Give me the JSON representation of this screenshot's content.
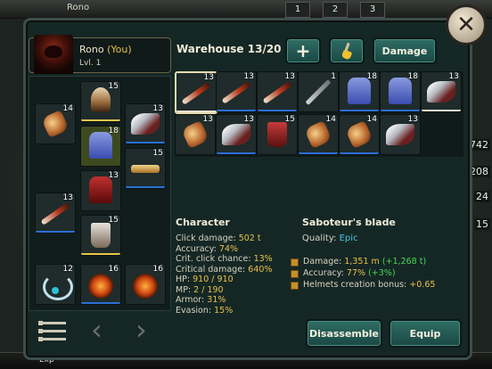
{
  "background": {
    "top_name": "Rono",
    "top_slots": [
      "1",
      "2",
      "3"
    ],
    "right_numbers": [
      "742",
      "208",
      "24",
      "15"
    ],
    "exp_label": "Exp"
  },
  "hero": {
    "name": "Rono",
    "you_label": "(You)",
    "level": "Lvl. 1"
  },
  "equipment": [
    {
      "name": "gauntlet-slot",
      "count": "14",
      "icon": "gauntlet-icon",
      "bar": ""
    },
    {
      "name": "helmet-slot",
      "count": "15",
      "icon": "helmet-icon",
      "bar": "#e8c54a"
    },
    {
      "name": "wings-slot",
      "count": "13",
      "icon": "wings-icon",
      "bar": "#2b6fd6"
    },
    {
      "name": "armor-slot",
      "count": "18",
      "icon": "armor-icon",
      "bar": "",
      "highlight": true
    },
    {
      "name": "belt-slot",
      "count": "15",
      "icon": "belt-icon",
      "bar": "#2b6fd6"
    },
    {
      "name": "pants-slot",
      "count": "13",
      "icon": "pants-icon",
      "bar": ""
    },
    {
      "name": "weapon-slot",
      "count": "13",
      "icon": "sword-icon",
      "bar": "#2b6fd6"
    },
    {
      "name": "boots-slot",
      "count": "15",
      "icon": "boots-icon",
      "bar": "#e8c54a"
    },
    {
      "name": "necklace-slot",
      "count": "12",
      "icon": "necklace-icon",
      "bar": ""
    },
    {
      "name": "ring-left-slot",
      "count": "16",
      "icon": "ring-icon",
      "bar": "#2b6fd6"
    },
    {
      "name": "ring-right-slot",
      "count": "16",
      "icon": "ring-icon",
      "bar": ""
    }
  ],
  "warehouse": {
    "title": "Warehouse 13/20",
    "add_label": "+",
    "damage_label": "Damage",
    "items": [
      {
        "count": "13",
        "icon": "sword-icon",
        "bar": "#e8e2cf",
        "selected": true
      },
      {
        "count": "13",
        "icon": "sword-icon",
        "bar": "#2b6fd6"
      },
      {
        "count": "13",
        "icon": "sword-icon",
        "bar": "#2b6fd6"
      },
      {
        "count": "1",
        "icon": "plain-sword-icon",
        "bar": ""
      },
      {
        "count": "18",
        "icon": "armor-icon",
        "bar": "#2b6fd6"
      },
      {
        "count": "18",
        "icon": "armor-icon",
        "bar": "#2b6fd6"
      },
      {
        "count": "13",
        "icon": "wings-icon",
        "bar": "#e8e2cf"
      },
      {
        "count": "13",
        "icon": "gauntlet-icon",
        "bar": ""
      },
      {
        "count": "13",
        "icon": "wings-icon",
        "bar": "#2b6fd6"
      },
      {
        "count": "15",
        "icon": "boots-icon",
        "bar": ""
      },
      {
        "count": "14",
        "icon": "gauntlet-icon",
        "bar": "#2b6fd6"
      },
      {
        "count": "14",
        "icon": "gauntlet-icon",
        "bar": "#2b6fd6"
      },
      {
        "count": "13",
        "icon": "wings-icon",
        "bar": ""
      }
    ]
  },
  "character": {
    "title": "Character",
    "stats": [
      {
        "label": "Click damage:",
        "value": "502 t"
      },
      {
        "label": "Accuracy:",
        "value": "74%"
      },
      {
        "label": "Crit. click chance:",
        "value": "13%"
      },
      {
        "label": "Critical damage:",
        "value": "640%"
      },
      {
        "label": "HP:",
        "value": "910 / 910"
      },
      {
        "label": "MP:",
        "value": "2 / 190"
      },
      {
        "label": "Armor:",
        "value": "31%"
      },
      {
        "label": "Evasion:",
        "value": "15%"
      }
    ]
  },
  "item": {
    "title": "Saboteur's blade",
    "quality_label": "Quality:",
    "quality_value": "Epic",
    "props": [
      {
        "label": "Damage:",
        "value": "1,351 m",
        "bonus": "(+1,268 t)"
      },
      {
        "label": "Accuracy:",
        "value": "77%",
        "bonus": "(+3%)"
      },
      {
        "label": "Helmets creation bonus:",
        "value": "+0.65",
        "bonus": ""
      }
    ]
  },
  "actions": {
    "disassemble_label": "Disassemble",
    "equip_label": "Equip"
  },
  "colors": {
    "accent_gold": "#e8c04a",
    "epic_blue": "#46c6e6",
    "bonus_green": "#48d858",
    "button_teal": "#2f6d65"
  }
}
